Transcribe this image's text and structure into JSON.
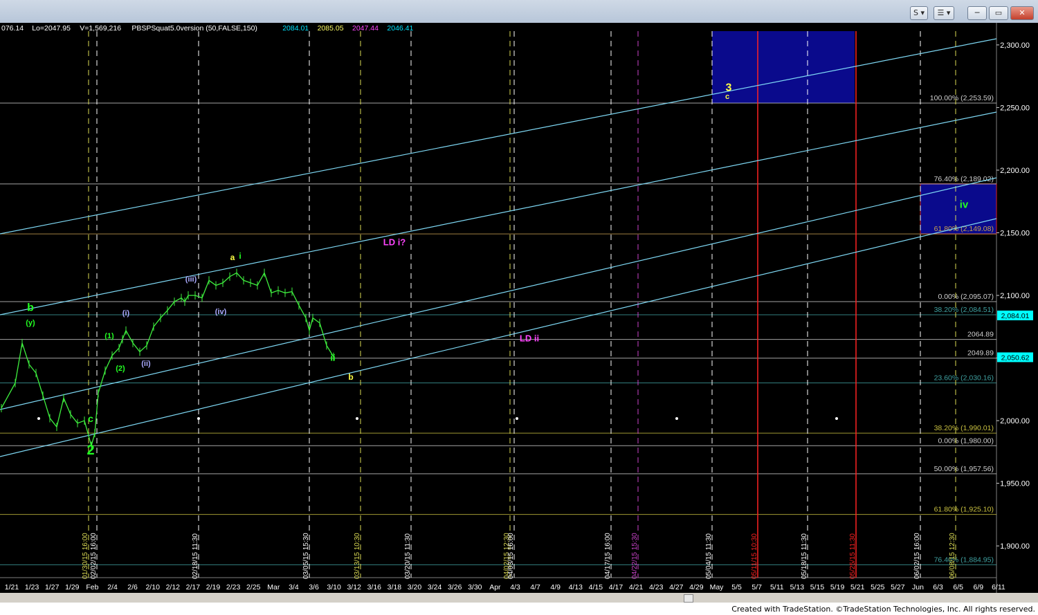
{
  "window": {
    "buttons": [
      {
        "name": "symbol-button",
        "label": "S"
      },
      {
        "name": "interval-button",
        "label": "☰"
      }
    ]
  },
  "header": {
    "segments": [
      {
        "text": "076.14",
        "color": "#ffffff"
      },
      {
        "text": "Lo=2047.95",
        "color": "#ffffff"
      },
      {
        "text": "V=1,569,216",
        "color": "#ffffff"
      },
      {
        "text": "PBSPSquat5.0version (50,FALSE,150)",
        "color": "#ffffff"
      },
      {
        "text": "2084.01",
        "color": "#00e5ff"
      },
      {
        "text": "2085.05",
        "color": "#ffff66"
      },
      {
        "text": "2047.44",
        "color": "#ff44ff"
      },
      {
        "text": "2046.41",
        "color": "#00e5ff"
      }
    ]
  },
  "chart_data": {
    "type": "line",
    "ylim": [
      1873.0,
      2311.0
    ],
    "yticks": [
      1900,
      1950,
      2000,
      2050,
      2100,
      2150,
      2200,
      2250,
      2300
    ],
    "ytick_labels": [
      "1,900.00",
      "1,950.00",
      "2,000.00",
      "2,050.00",
      "2,100.00",
      "2,150.00",
      "2,200.00",
      "2,250.00",
      "2,300.00"
    ],
    "last_price": {
      "value": 2084.01,
      "label": "2,084.01",
      "color": "#00ffff"
    },
    "current_price": {
      "value": 2050.62,
      "label": "2,050.62",
      "color": "#00ffff"
    },
    "x_dates": [
      "1/21",
      "1/23",
      "1/27",
      "1/29",
      "Feb",
      "2/4",
      "2/6",
      "2/10",
      "2/12",
      "2/17",
      "2/19",
      "2/23",
      "2/25",
      "Mar",
      "3/4",
      "3/6",
      "3/10",
      "3/12",
      "3/16",
      "3/18",
      "3/20",
      "3/24",
      "3/26",
      "3/30",
      "Apr",
      "4/3",
      "4/7",
      "4/9",
      "4/13",
      "4/15",
      "4/17",
      "4/21",
      "4/23",
      "4/27",
      "4/29",
      "May",
      "5/5",
      "5/7",
      "5/11",
      "5/13",
      "5/15",
      "5/19",
      "5/21",
      "5/25",
      "5/27",
      "Jun",
      "6/3",
      "6/5",
      "6/9",
      "6/11"
    ],
    "price_series": [
      [
        0,
        2010
      ],
      [
        2,
        2030
      ],
      [
        3,
        2062
      ],
      [
        4,
        2045
      ],
      [
        5,
        2038
      ],
      [
        6,
        2020
      ],
      [
        7,
        2002
      ],
      [
        8,
        1995
      ],
      [
        9,
        2018
      ],
      [
        10,
        2005
      ],
      [
        11,
        1998
      ],
      [
        12,
        2000
      ],
      [
        13,
        1980
      ],
      [
        13.5,
        1990
      ],
      [
        14,
        2022
      ],
      [
        15,
        2040
      ],
      [
        16,
        2052
      ],
      [
        17,
        2058
      ],
      [
        17.5,
        2065
      ],
      [
        18,
        2072
      ],
      [
        19,
        2062
      ],
      [
        20,
        2055
      ],
      [
        21,
        2060
      ],
      [
        22,
        2075
      ],
      [
        23,
        2082
      ],
      [
        24,
        2088
      ],
      [
        25,
        2095
      ],
      [
        26,
        2098
      ],
      [
        26.5,
        2095
      ],
      [
        27,
        2100
      ],
      [
        28,
        2100
      ],
      [
        29,
        2098
      ],
      [
        30,
        2112
      ],
      [
        31,
        2108
      ],
      [
        32,
        2110
      ],
      [
        33,
        2115
      ],
      [
        34,
        2118
      ],
      [
        35,
        2112
      ],
      [
        36,
        2110
      ],
      [
        37,
        2108
      ],
      [
        38,
        2118
      ],
      [
        39,
        2102
      ],
      [
        40,
        2104
      ],
      [
        41,
        2102
      ],
      [
        42,
        2103
      ],
      [
        43,
        2092
      ],
      [
        44,
        2082
      ],
      [
        44.5,
        2072
      ],
      [
        45,
        2082
      ],
      [
        46,
        2078
      ],
      [
        47,
        2060
      ],
      [
        48,
        2051
      ]
    ],
    "horizontal_levels": [
      {
        "value": 2253.59,
        "label": "100.00% (2,253.59)",
        "color": "#cfcfcf"
      },
      {
        "value": 2189.02,
        "label": "76.40% (2,189.02)",
        "color": "#cfcfcf"
      },
      {
        "value": 2149.08,
        "label": "61.80% (2,149.08)",
        "color": "#c8a050"
      },
      {
        "value": 2095.07,
        "label": "0.00% (2,095.07)",
        "color": "#cfcfcf"
      },
      {
        "value": 2084.51,
        "label": "38.20% (2,084.51)",
        "color": "#3fa0a0"
      },
      {
        "value": 2064.89,
        "label": "2064.89",
        "color": "#cfcfcf"
      },
      {
        "value": 2049.89,
        "label": "2049.89",
        "color": "#cfcfcf"
      },
      {
        "value": 2030.16,
        "label": "23.60% (2,030.16)",
        "color": "#3fa0a0"
      },
      {
        "value": 1990.01,
        "label": "38.20% (1,990.01)",
        "color": "#c8c040"
      },
      {
        "value": 1980.0,
        "label": "0.00% (1,980.00)",
        "color": "#cfcfcf"
      },
      {
        "value": 1957.56,
        "label": "50.00% (1,957.56)",
        "color": "#cfcfcf"
      },
      {
        "value": 1925.1,
        "label": "61.80% (1,925.10)",
        "color": "#c8c040"
      },
      {
        "value": 1884.95,
        "label": "76.40% (1,884.95)",
        "color": "#3fa0a0"
      }
    ],
    "vertical_markers": [
      {
        "label": "01/30/15 16:00",
        "color": "#dddd55"
      },
      {
        "label": "02/02/15 16:00",
        "color": "#ffffff"
      },
      {
        "label": "02/18/15 11:30",
        "color": "#ffffff"
      },
      {
        "label": "03/05/15 15:30",
        "color": "#ffffff"
      },
      {
        "label": "03/13/15 10:30",
        "color": "#dddd55"
      },
      {
        "label": "03/20/15 11:30",
        "color": "#ffffff"
      },
      {
        "label": "04/02/15 12:30",
        "color": "#dddd55"
      },
      {
        "label": "04/03/15 16:00",
        "color": "#ffffff"
      },
      {
        "label": "04/17/15 16:00",
        "color": "#ffffff"
      },
      {
        "label": "04/22/15 15:30",
        "color": "#cc44cc"
      },
      {
        "label": "05/04/15 11:30",
        "color": "#ffffff"
      },
      {
        "label": "05/11/15 10:30",
        "color": "#ff2222"
      },
      {
        "label": "05/18/15 11:30",
        "color": "#ffffff"
      },
      {
        "label": "05/25/15 11:30",
        "color": "#ff2222"
      },
      {
        "label": "06/02/15 16:00",
        "color": "#ffffff"
      },
      {
        "label": "06/08/15 12:30",
        "color": "#dddd55"
      }
    ],
    "wave_labels": [
      {
        "text": "b",
        "color": "#22ff22"
      },
      {
        "text": "(y)",
        "color": "#22ff22"
      },
      {
        "text": "c",
        "color": "#22ff22"
      },
      {
        "text": "2",
        "color": "#22ff22"
      },
      {
        "text": "(1)",
        "color": "#22ff22"
      },
      {
        "text": "(2)",
        "color": "#22ff22"
      },
      {
        "text": "(i)",
        "color": "#aaaaff"
      },
      {
        "text": "(ii)",
        "color": "#aaaaff"
      },
      {
        "text": "(iii)",
        "color": "#aaaaff"
      },
      {
        "text": "(iv)",
        "color": "#aaaaff"
      },
      {
        "text": "a",
        "color": "#ffff44"
      },
      {
        "text": "i",
        "color": "#22ff22"
      },
      {
        "text": "ii",
        "color": "#22ff22"
      },
      {
        "text": "b",
        "color": "#ffff44"
      },
      {
        "text": "LD i?",
        "color": "#ff44ff"
      },
      {
        "text": "LD ii",
        "color": "#ff44ff"
      },
      {
        "text": "3",
        "color": "#ffff44"
      },
      {
        "text": "c",
        "color": "#ffff44"
      },
      {
        "text": "iv",
        "color": "#22ff22"
      }
    ],
    "target_boxes": [
      {
        "name": "wave-3-target",
        "low": 2253.59,
        "high": 2311,
        "fill": "#0a0a8c"
      },
      {
        "name": "wave-iv-target",
        "low": 2149.08,
        "high": 2189.02,
        "fill": "#0a0a8c"
      }
    ],
    "grid": false
  },
  "footer": {
    "credit": "Created with TradeStation. ©TradeStation Technologies, Inc. All rights reserved."
  }
}
